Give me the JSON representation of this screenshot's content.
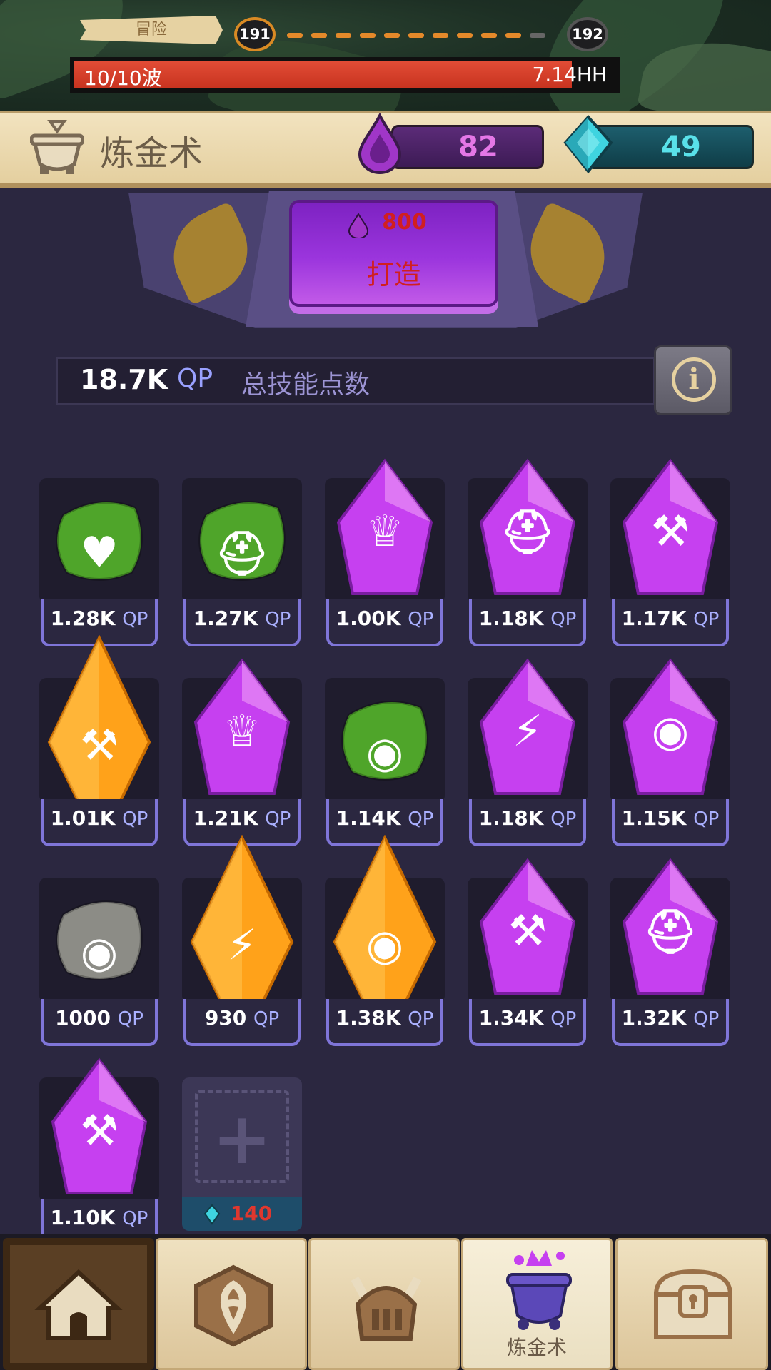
{
  "top_bar": {
    "stage_label": "冒险",
    "current_level": "191",
    "next_level": "192",
    "wave_text": "10/10波",
    "enemy_hp": "7.14HH",
    "wave_progress": 0.92
  },
  "header": {
    "title": "炼金术",
    "elixir": "82",
    "gems": "49"
  },
  "craft": {
    "cost": "800",
    "label": "打造"
  },
  "qp": {
    "total": "18.7K",
    "unit": "QP",
    "label": "总技能点数"
  },
  "slots": [
    {
      "qp": "1.28K",
      "gem": "green",
      "icon": "heart-icon"
    },
    {
      "qp": "1.27K",
      "gem": "green",
      "icon": "helmet-icon"
    },
    {
      "qp": "1.00K",
      "gem": "purple",
      "icon": "crown-ring-icon"
    },
    {
      "qp": "1.18K",
      "gem": "purple",
      "icon": "helmet-icon"
    },
    {
      "qp": "1.17K",
      "gem": "purple",
      "icon": "hammer-icon"
    },
    {
      "qp": "1.01K",
      "gem": "orange",
      "icon": "hammer-icon"
    },
    {
      "qp": "1.21K",
      "gem": "purple",
      "icon": "crown-ring-icon"
    },
    {
      "qp": "1.14K",
      "gem": "green",
      "icon": "money-bag-icon"
    },
    {
      "qp": "1.18K",
      "gem": "purple",
      "icon": "lightning-icon"
    },
    {
      "qp": "1.15K",
      "gem": "purple",
      "icon": "money-bag-icon"
    },
    {
      "qp": "1000",
      "gem": "gray",
      "icon": "money-bag-icon"
    },
    {
      "qp": "930",
      "gem": "orange",
      "icon": "lightning-icon"
    },
    {
      "qp": "1.38K",
      "gem": "orange",
      "icon": "money-bag-icon"
    },
    {
      "qp": "1.34K",
      "gem": "purple",
      "icon": "hammer-icon"
    },
    {
      "qp": "1.32K",
      "gem": "purple",
      "icon": "helmet-icon"
    },
    {
      "qp": "1.10K",
      "gem": "purple",
      "icon": "hammer-icon"
    }
  ],
  "add_slot": {
    "cost": "140"
  },
  "nav": {
    "active_label": "炼金术",
    "tabs": [
      "home-icon",
      "rune-icon",
      "hero-helmet-icon",
      "cauldron-icon",
      "chest-icon"
    ]
  },
  "colors": {
    "green": "#4fa52a",
    "purple": "#c640f0",
    "orange": "#ffa21a",
    "gray": "#8c8c86",
    "accent_elixir": "#e477e6",
    "accent_gem": "#59e1ea",
    "cost_red": "#d11f1f"
  }
}
